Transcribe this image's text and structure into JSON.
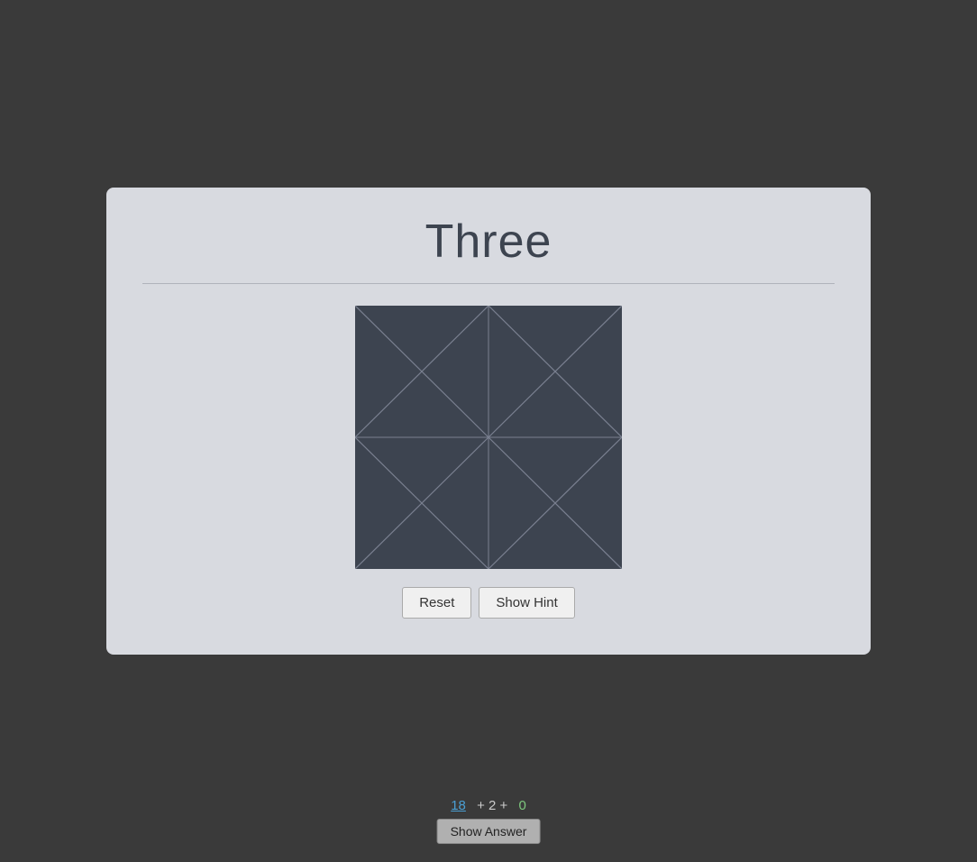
{
  "card": {
    "title": "Three",
    "divider": true
  },
  "buttons": {
    "reset_label": "Reset",
    "show_hint_label": "Show Hint"
  },
  "bottom": {
    "score_blue": "18",
    "score_middle": "+ 2 +",
    "score_green": "0",
    "show_answer_label": "Show Answer"
  }
}
